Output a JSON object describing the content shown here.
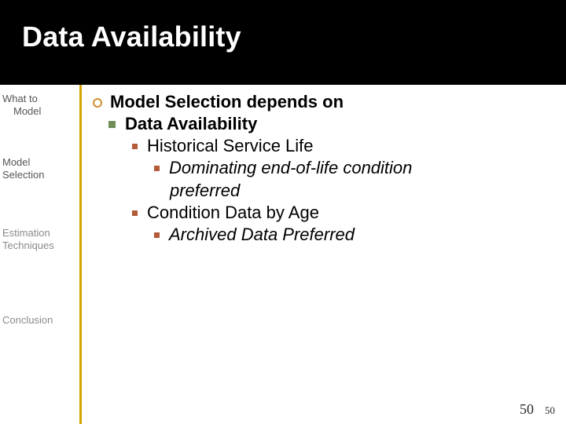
{
  "title": "Data Availability",
  "nav": {
    "items": [
      {
        "line1": "What to",
        "line2": "Model"
      },
      {
        "line1": "Model",
        "line2": "Selection"
      },
      {
        "line1": "Estimation",
        "line2": "Techniques"
      },
      {
        "line1": "Conclusion",
        "line2": ""
      }
    ]
  },
  "colors": {
    "divider": "#d6a500",
    "circle": "#cf8f2a",
    "square": "#6f8d5a",
    "subsquare": "#b35a38"
  },
  "content": {
    "l1": "Model Selection depends on",
    "l2": "Data Availability",
    "l3a": "Historical Service Life",
    "l4a_1": "Dominating end-of-life condition",
    "l4a_2": "preferred",
    "l3b": "Condition Data by Age",
    "l4b": "Archived Data Preferred"
  },
  "page": {
    "big": "50",
    "small": "50"
  }
}
